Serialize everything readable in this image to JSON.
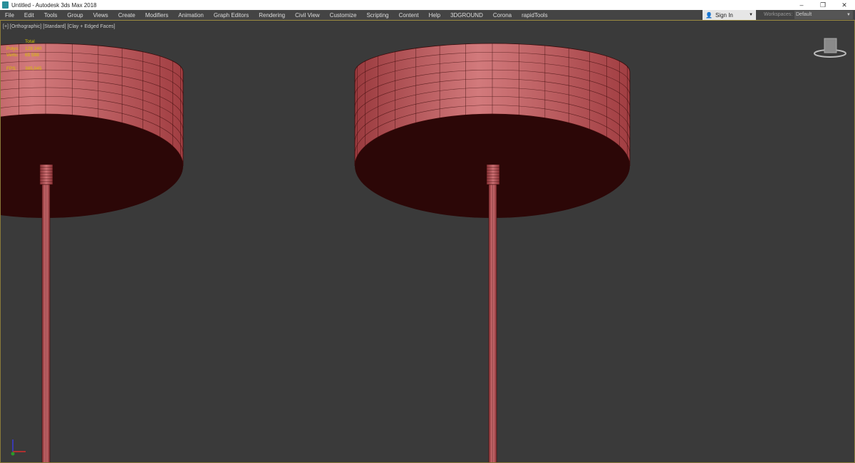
{
  "window": {
    "title": "Untitled - Autodesk 3ds Max 2018",
    "controls": [
      "–",
      "❐",
      "✕"
    ]
  },
  "menu": [
    "File",
    "Edit",
    "Tools",
    "Group",
    "Views",
    "Create",
    "Modifiers",
    "Animation",
    "Graph Editors",
    "Rendering",
    "Civil View",
    "Customize",
    "Scripting",
    "Content",
    "Help",
    "3DGROUND",
    "Corona",
    "rapidTools"
  ],
  "account": {
    "sign_in": "Sign In"
  },
  "workspaces": {
    "label": "Workspaces:",
    "value": "Default"
  },
  "viewport": {
    "label": "[+] [Orthographic] [Standard] [Clay + Edged Faces]"
  },
  "stats": {
    "header": "Total",
    "rows": [
      {
        "k": "Polys:",
        "v": "129 240"
      },
      {
        "k": "Verts:",
        "v": "65 598"
      },
      {
        "k": "FPS:",
        "v": "385,045"
      }
    ]
  },
  "colors": {
    "mesh": "#b5474b",
    "underside": "#2c0707",
    "wire": "#3a0a0a",
    "background": "#3a3a3a"
  }
}
